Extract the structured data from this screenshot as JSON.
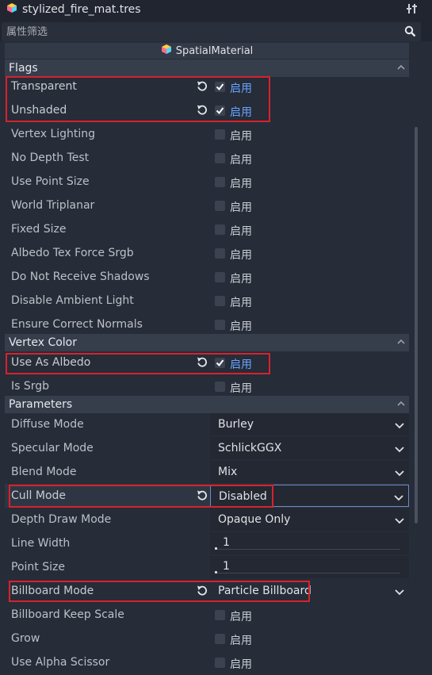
{
  "titlebar": {
    "filename": "stylized_fire_mat.tres",
    "tools_icon": "tools-icon"
  },
  "filter": {
    "placeholder": "属性筛选",
    "search_icon": "search-icon"
  },
  "header": {
    "title": "SpatialMaterial"
  },
  "check_label": "启用",
  "sections": {
    "flags": "Flags",
    "vertex_color": "Vertex Color",
    "parameters": "Parameters"
  },
  "flags": [
    {
      "label": "Transparent",
      "checked": true
    },
    {
      "label": "Unshaded",
      "checked": true
    },
    {
      "label": "Vertex Lighting",
      "checked": false
    },
    {
      "label": "No Depth Test",
      "checked": false
    },
    {
      "label": "Use Point Size",
      "checked": false
    },
    {
      "label": "World Triplanar",
      "checked": false
    },
    {
      "label": "Fixed Size",
      "checked": false
    },
    {
      "label": "Albedo Tex Force Srgb",
      "checked": false
    },
    {
      "label": "Do Not Receive Shadows",
      "checked": false
    },
    {
      "label": "Disable Ambient Light",
      "checked": false
    },
    {
      "label": "Ensure Correct Normals",
      "checked": false
    }
  ],
  "vertex_color": [
    {
      "label": "Use As Albedo",
      "checked": true
    },
    {
      "label": "Is Srgb",
      "checked": false
    }
  ],
  "parameters": {
    "diffuse_mode": {
      "label": "Diffuse Mode",
      "value": "Burley"
    },
    "specular_mode": {
      "label": "Specular Mode",
      "value": "SchlickGGX"
    },
    "blend_mode": {
      "label": "Blend Mode",
      "value": "Mix"
    },
    "cull_mode": {
      "label": "Cull Mode",
      "value": "Disabled"
    },
    "depth_draw_mode": {
      "label": "Depth Draw Mode",
      "value": "Opaque Only"
    },
    "line_width": {
      "label": "Line Width",
      "value": "1"
    },
    "point_size": {
      "label": "Point Size",
      "value": "1"
    },
    "billboard_mode": {
      "label": "Billboard Mode",
      "value": "Particle Billboard"
    },
    "billboard_keep_scale": {
      "label": "Billboard Keep Scale",
      "checked": false
    },
    "grow": {
      "label": "Grow",
      "checked": false
    },
    "use_alpha_scissor": {
      "label": "Use Alpha Scissor",
      "checked": false
    }
  },
  "colors": {
    "highlight": "#d8222c",
    "enabled_text": "#66a5ff"
  }
}
